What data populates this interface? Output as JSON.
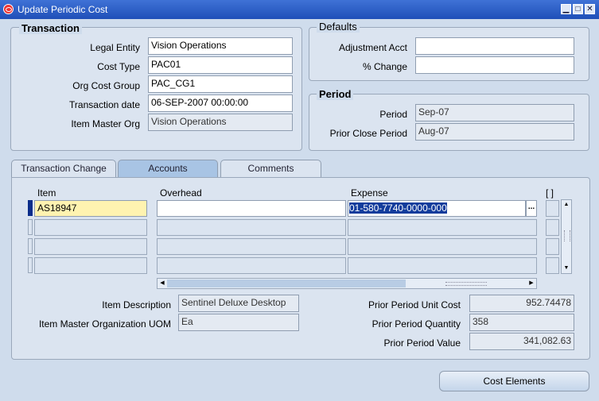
{
  "window": {
    "title": "Update Periodic Cost",
    "minimize": "▁",
    "maximize": "□",
    "close": "✕"
  },
  "transaction": {
    "title": "Transaction",
    "legal_entity_label": "Legal Entity",
    "legal_entity": "Vision Operations",
    "cost_type_label": "Cost Type",
    "cost_type": "PAC01",
    "org_cost_group_label": "Org Cost Group",
    "org_cost_group": "PAC_CG1",
    "transaction_date_label": "Transaction date",
    "transaction_date": "06-SEP-2007 00:00:00",
    "item_master_org_label": "Item Master Org",
    "item_master_org": "Vision Operations"
  },
  "defaults": {
    "title": "Defaults",
    "adjustment_acct_label": "Adjustment Acct",
    "adjustment_acct": "",
    "pct_change_label": "% Change",
    "pct_change": ""
  },
  "period": {
    "title": "Period",
    "period_label": "Period",
    "period": "Sep-07",
    "prior_close_label": "Prior Close Period",
    "prior_close": "Aug-07"
  },
  "tabs": [
    {
      "label": "Transaction Change"
    },
    {
      "label": "Accounts"
    },
    {
      "label": "Comments"
    }
  ],
  "grid": {
    "col_item": "Item",
    "col_overhead": "Overhead",
    "col_expense": "Expense",
    "col_flex": "[ ]",
    "row1_item": "AS18947",
    "row1_overhead": "",
    "row1_expense": "01-580-7740-0000-000",
    "lov": "..."
  },
  "details": {
    "item_desc_label": "Item Description",
    "item_desc": "Sentinel Deluxe Desktop",
    "uom_label": "Item Master Organization UOM",
    "uom": "Ea",
    "prior_unit_cost_label": "Prior Period Unit Cost",
    "prior_unit_cost": "952.74478",
    "prior_qty_label": "Prior Period Quantity",
    "prior_qty": "358",
    "prior_value_label": "Prior Period Value",
    "prior_value": "341,082.63"
  },
  "buttons": {
    "cost_elements": "Cost Elements"
  }
}
